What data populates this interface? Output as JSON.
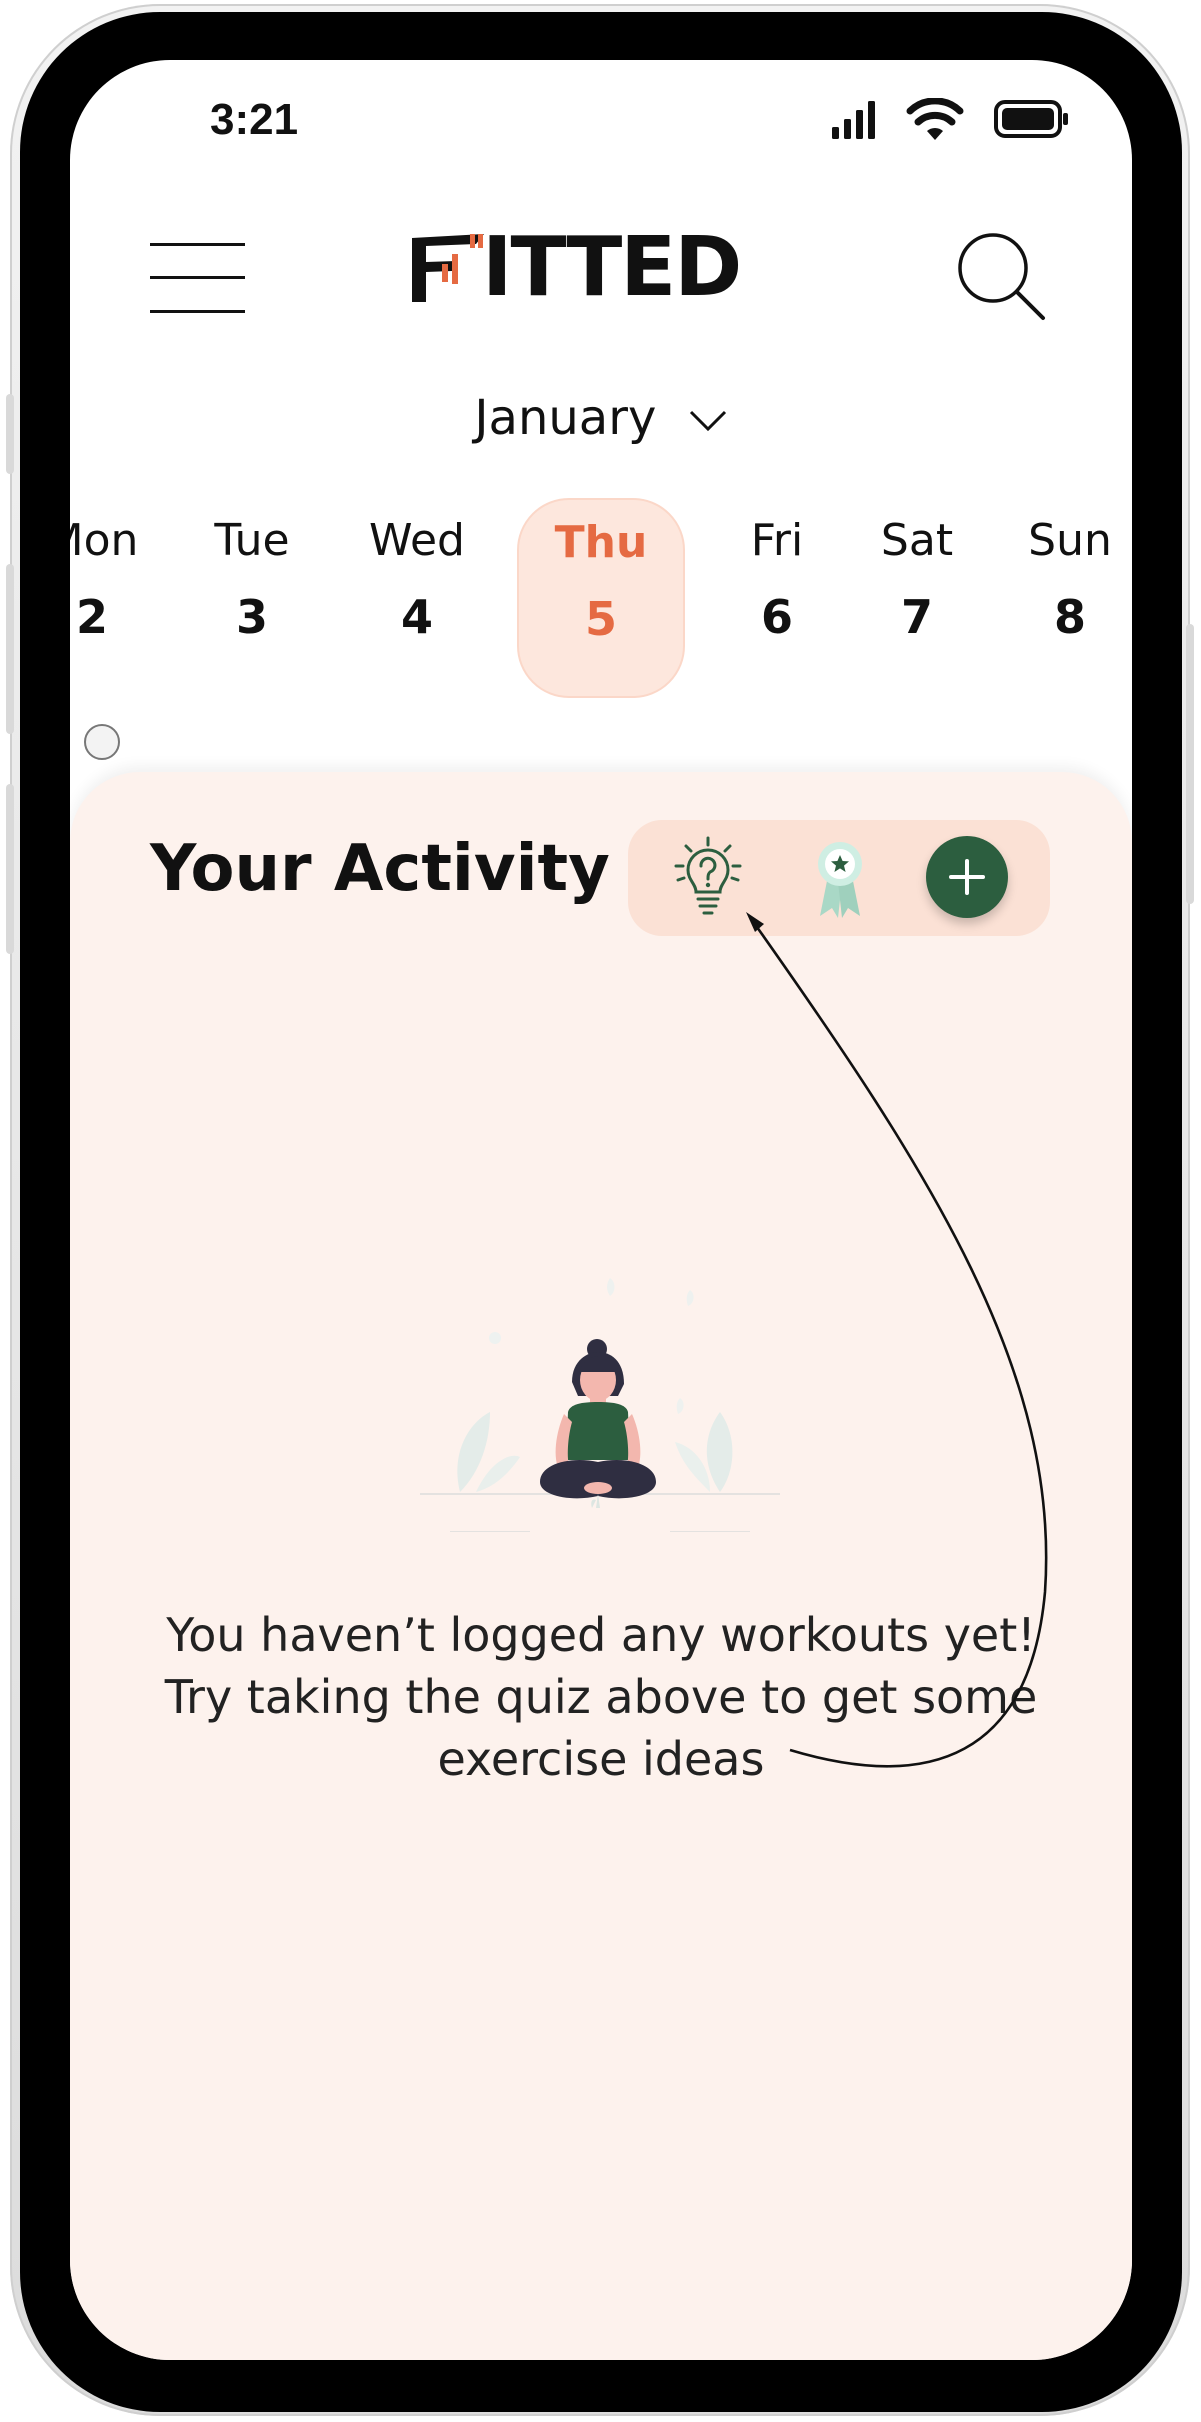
{
  "status_bar": {
    "time": "3:21",
    "icons": [
      "signal-icon",
      "wifi-icon",
      "battery-icon"
    ]
  },
  "header": {
    "logo_text": "ITTED",
    "menu_icon": "hamburger-menu-icon",
    "search_icon": "search-icon"
  },
  "month_selector": {
    "label": "January",
    "icon": "chevron-down-icon"
  },
  "week": [
    {
      "day": "Mon",
      "date": "2",
      "selected": false,
      "has_dot": true
    },
    {
      "day": "Tue",
      "date": "3",
      "selected": false,
      "has_dot": false
    },
    {
      "day": "Wed",
      "date": "4",
      "selected": false,
      "has_dot": false
    },
    {
      "day": "Thu",
      "date": "5",
      "selected": true,
      "has_dot": false
    },
    {
      "day": "Fri",
      "date": "6",
      "selected": false,
      "has_dot": false
    },
    {
      "day": "Sat",
      "date": "7",
      "selected": false,
      "has_dot": false
    },
    {
      "day": "Sun",
      "date": "8",
      "selected": false,
      "has_dot": false
    }
  ],
  "activity": {
    "title": "Your Activity",
    "tools": [
      "lightbulb-quiz-icon",
      "award-ribbon-icon",
      "plus-icon"
    ],
    "empty_message": [
      "You haven’t logged any workouts yet!",
      "Try taking the quiz above to get some",
      "exercise ideas"
    ]
  },
  "colors": {
    "accent_orange": "#e56a42",
    "selected_day_bg": "#fde7dd",
    "panel_bg": "#fdf2ed",
    "toolbar_bg": "#fbe1d5",
    "primary_green": "#2c5e3f",
    "text": "#111111"
  }
}
